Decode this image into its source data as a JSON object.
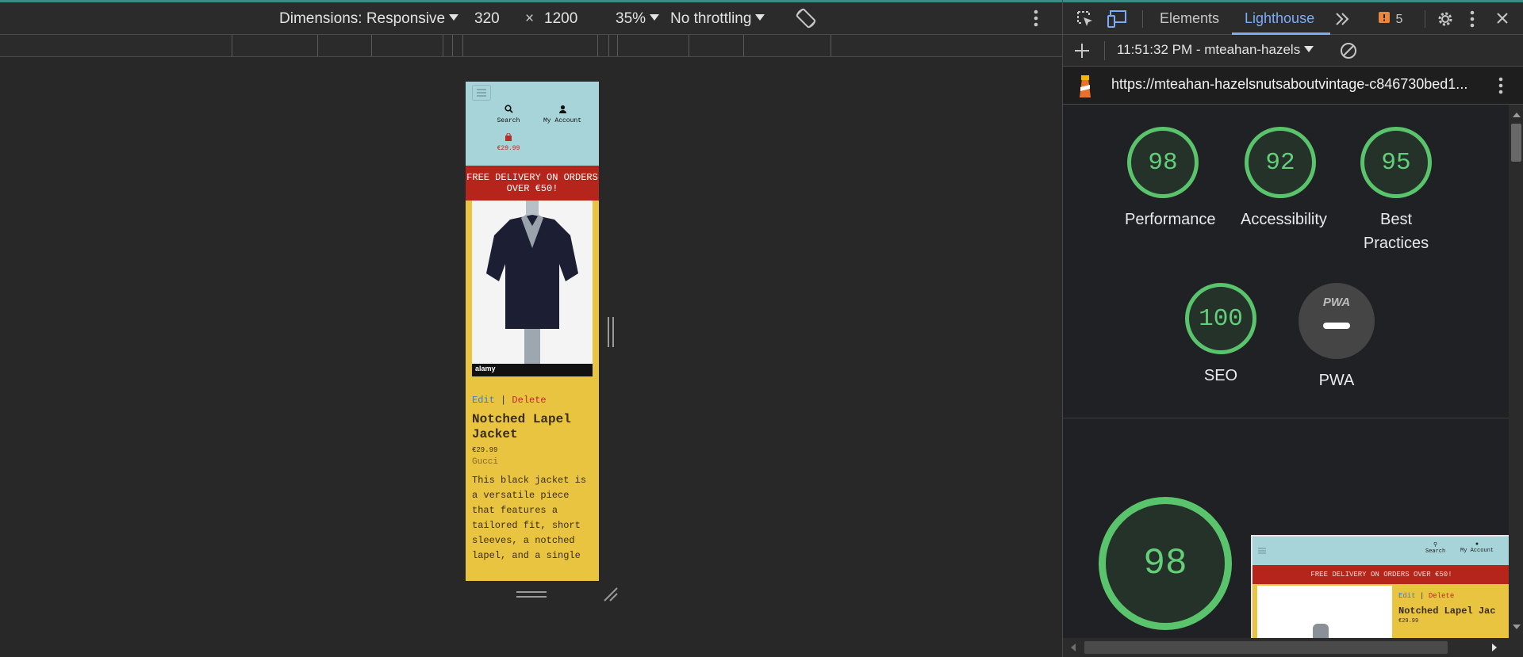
{
  "device_toolbar": {
    "dimensions_label": "Dimensions: Responsive",
    "width_value": "320",
    "times": "×",
    "height_value": "1200",
    "zoom_label": "35%",
    "throttling_label": "No throttling"
  },
  "preview": {
    "search_label": "Search",
    "account_label": "My Account",
    "cart_total": "€29.99",
    "banner_text": "FREE DELIVERY ON ORDERS OVER €50!",
    "image_brand": "alamy",
    "edit_label": "Edit",
    "separator": "|",
    "delete_label": "Delete",
    "product_title": "Notched Lapel Jacket",
    "product_price": "€29.99",
    "product_brand": "Gucci",
    "product_description": "This black jacket is a versatile piece that features a tailored fit, short sleeves, a notched lapel, and a single"
  },
  "devtools": {
    "tabs": [
      "Elements",
      "Lighthouse"
    ],
    "active_tab": "Lighthouse",
    "issues_count": "5",
    "report_label": "11:51:32 PM - mteahan-hazels",
    "url": "https://mteahan-hazelsnutsaboutvintage-c846730bed1...",
    "scores": [
      {
        "label": "Performance",
        "value": "98"
      },
      {
        "label": "Accessibility",
        "value": "92"
      },
      {
        "label": "Best Practices",
        "value": "95"
      },
      {
        "label": "SEO",
        "value": "100"
      },
      {
        "label": "PWA",
        "value": "PWA"
      }
    ],
    "big_score": "98",
    "thumb": {
      "search_label": "Search",
      "account_label": "My Account",
      "banner_text": "FREE DELIVERY ON ORDERS OVER €50!",
      "edit_label": "Edit",
      "delete_label": "Delete",
      "product_title": "Notched Lapel Jac",
      "product_price": "€29.99"
    }
  },
  "colors": {
    "accent": "#3e8a85",
    "score_green": "#5ac46c",
    "banner_red": "#b5251c",
    "header_teal": "#a6d4d8",
    "page_yellow": "#e8c440"
  }
}
